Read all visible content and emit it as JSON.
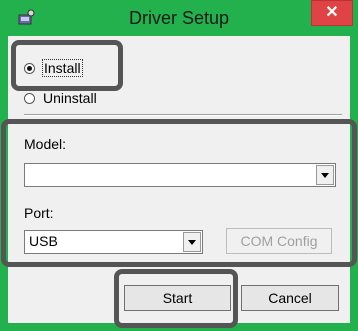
{
  "window": {
    "title": "Driver Setup",
    "close_glyph": "✕",
    "app_icon": "setup-icon"
  },
  "mode": {
    "install_label": "Install",
    "uninstall_label": "Uninstall",
    "selected": "install"
  },
  "model": {
    "label": "Model:",
    "value": ""
  },
  "port": {
    "label": "Port:",
    "value": "USB",
    "com_config_label": "COM Config"
  },
  "actions": {
    "start_label": "Start",
    "cancel_label": "Cancel"
  },
  "colors": {
    "titlebar": "#22b14c",
    "close": "#e04343",
    "highlight": "#555555"
  }
}
